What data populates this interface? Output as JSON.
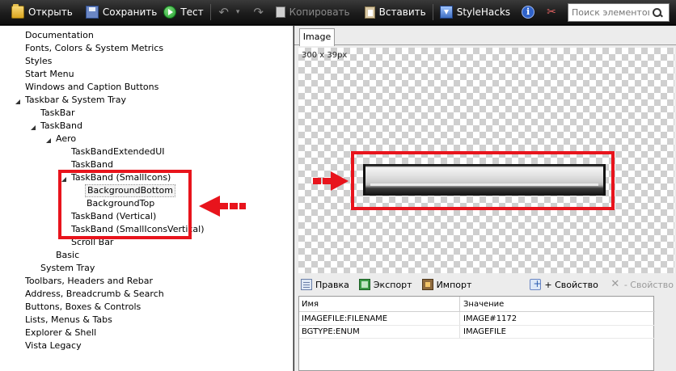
{
  "toolbar": {
    "open_label": "Открыть",
    "save_label": "Сохранить",
    "test_label": "Тест",
    "copy_label": "Копировать",
    "paste_label": "Вставить",
    "stylehacks_label": "StyleHacks",
    "search_placeholder": "Поиск элементов"
  },
  "tree": {
    "items": [
      {
        "label": "Documentation",
        "expander": "closed"
      },
      {
        "label": "Fonts, Colors & System Metrics",
        "expander": "closed"
      },
      {
        "label": "Styles",
        "expander": "closed"
      },
      {
        "label": "Start Menu",
        "expander": "closed"
      },
      {
        "label": "Windows and Caption Buttons",
        "expander": "closed"
      },
      {
        "label": "Taskbar & System Tray",
        "expander": "open"
      },
      {
        "label": "TaskBar",
        "expander": "closed"
      },
      {
        "label": "TaskBand",
        "expander": "open"
      },
      {
        "label": "Aero",
        "expander": "open"
      },
      {
        "label": "TaskBandExtendedUI",
        "expander": "closed"
      },
      {
        "label": "TaskBand",
        "expander": "closed"
      },
      {
        "label": "TaskBand (SmallIcons)",
        "expander": "open"
      },
      {
        "label": "BackgroundBottom",
        "expander": "none",
        "selected": true
      },
      {
        "label": "BackgroundTop",
        "expander": "none"
      },
      {
        "label": "TaskBand (Vertical)",
        "expander": "closed"
      },
      {
        "label": "TaskBand (SmallIconsVertical)",
        "expander": "closed"
      },
      {
        "label": "Scroll Bar",
        "expander": "closed"
      },
      {
        "label": "Basic",
        "expander": "closed"
      },
      {
        "label": "System Tray",
        "expander": "closed"
      },
      {
        "label": "Toolbars, Headers and Rebar",
        "expander": "closed"
      },
      {
        "label": "Address, Breadcrumb & Search",
        "expander": "closed"
      },
      {
        "label": "Buttons, Boxes & Controls",
        "expander": "closed"
      },
      {
        "label": "Lists, Menus & Tabs",
        "expander": "closed"
      },
      {
        "label": "Explorer & Shell",
        "expander": "closed"
      },
      {
        "label": "Vista Legacy",
        "expander": "closed"
      }
    ]
  },
  "image_panel": {
    "tab_label": "Image",
    "size_label": "300 x 39px"
  },
  "properties": {
    "edit_label": "Правка",
    "export_label": "Экспорт",
    "import_label": "Импорт",
    "add_label": "+ Свойство",
    "remove_label": "- Свойство",
    "col_name": "Имя",
    "col_value": "Значение",
    "rows": [
      {
        "name": "IMAGEFILE:FILENAME",
        "value": "IMAGE#1172"
      },
      {
        "name": "BGTYPE:ENUM",
        "value": "IMAGEFILE"
      }
    ]
  },
  "colors": {
    "annotation_red": "#e8141c",
    "toolbar_bg": "#1c1c1c"
  }
}
